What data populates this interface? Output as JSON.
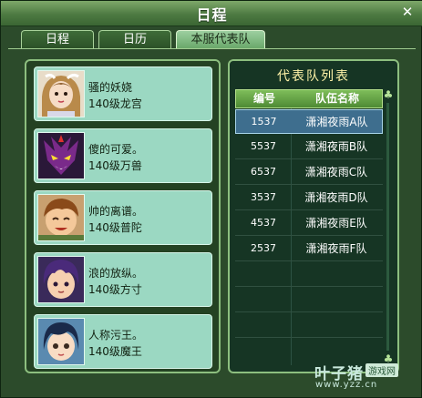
{
  "window": {
    "title": "日程",
    "close_glyph": "✕"
  },
  "tabs": [
    {
      "label": "日程",
      "active": false
    },
    {
      "label": "日历",
      "active": false
    },
    {
      "label": "本服代表队",
      "active": true
    }
  ],
  "players": [
    {
      "name": "骚的妖娆",
      "level": "140级龙宫",
      "avatar": "female-hero-avatar"
    },
    {
      "name": "傻的可爱。",
      "level": "140级万兽",
      "avatar": "demon-beast-avatar"
    },
    {
      "name": "帅的离谱。",
      "level": "140级普陀",
      "avatar": "brown-hair-boy-avatar"
    },
    {
      "name": "浪的放纵。",
      "level": "140级方寸",
      "avatar": "purple-hair-boy-avatar"
    },
    {
      "name": "人称污王。",
      "level": "140级魔王",
      "avatar": "dark-hair-girl-avatar"
    }
  ],
  "team_list": {
    "title": "代表队列表",
    "headers": {
      "id": "编号",
      "name": "队伍名称"
    },
    "rows": [
      {
        "id": "1537",
        "name": "潇湘夜雨A队",
        "selected": true
      },
      {
        "id": "5537",
        "name": "潇湘夜雨B队",
        "selected": false
      },
      {
        "id": "6537",
        "name": "潇湘夜雨C队",
        "selected": false
      },
      {
        "id": "3537",
        "name": "潇湘夜雨D队",
        "selected": false
      },
      {
        "id": "4537",
        "name": "潇湘夜雨E队",
        "selected": false
      },
      {
        "id": "2537",
        "name": "潇湘夜雨F队",
        "selected": false
      }
    ]
  },
  "watermark": {
    "brand": "叶子猪",
    "badge": "游戏网",
    "url": "www.yzz.cn"
  },
  "colors": {
    "frame": "#2c4b2b",
    "card": "#9bd8c2",
    "selected_row": "#3e6e8e",
    "list_title": "#fff3a8"
  }
}
